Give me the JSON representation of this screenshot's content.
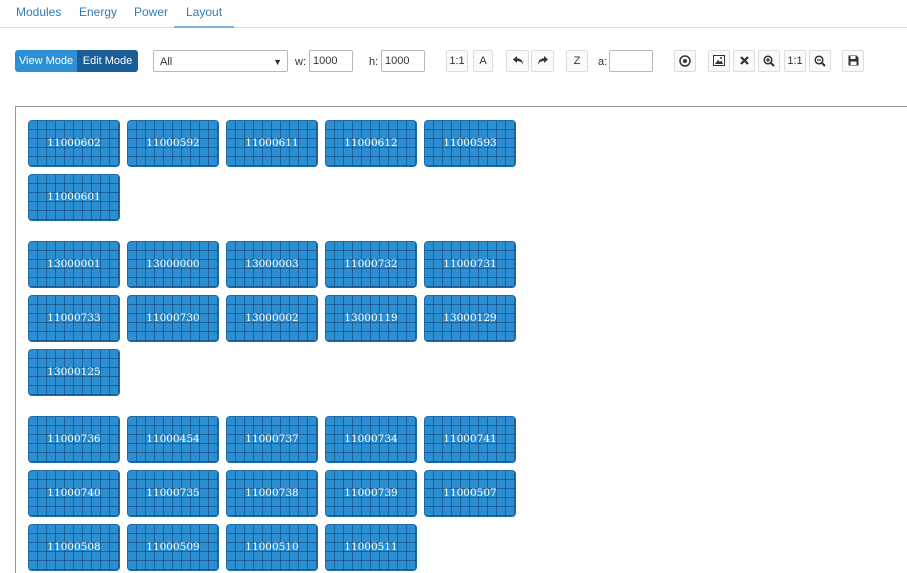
{
  "tabs": [
    {
      "label": "Modules"
    },
    {
      "label": "Energy"
    },
    {
      "label": "Power"
    },
    {
      "label": "Layout",
      "active": true
    }
  ],
  "toolbar": {
    "view_mode": "View Mode",
    "edit_mode": "Edit Mode",
    "filter": {
      "value": "All",
      "options": [
        "All"
      ]
    },
    "width_label": "w:",
    "width_value": "1000",
    "height_label": "h:",
    "height_value": "1000",
    "ratio_label": "1:1",
    "auto_label": "A",
    "undo_icon": "undo-icon",
    "redo_icon": "redo-icon",
    "z_label": "Z",
    "angle_label": "a:",
    "angle_value": "",
    "target_icon": "target-icon",
    "image_icon": "image-icon",
    "clear_icon": "close-icon",
    "zoom_in_icon": "zoom-in-icon",
    "zoom_ratio_label": "1:1",
    "zoom_out_icon": "zoom-out-icon",
    "save_icon": "save-icon"
  },
  "colors": {
    "module_fill": "#2c8fd2",
    "module_grid": "#0f3c6e",
    "view_mode": "#2d8fd4",
    "edit_mode": "#1b5e96",
    "tab_text": "#337ab7"
  },
  "groups": [
    {
      "rows": [
        [
          "11000602",
          "11000592",
          "11000611",
          "11000612",
          "11000593"
        ],
        [
          "11000601"
        ]
      ]
    },
    {
      "rows": [
        [
          "13000001",
          "13000000",
          "13000003",
          "11000732",
          "11000731"
        ],
        [
          "11000733",
          "11000730",
          "13000002",
          "13000119",
          "13000129"
        ],
        [
          "13000125"
        ]
      ]
    },
    {
      "rows": [
        [
          "11000736",
          "11000454",
          "11000737",
          "11000734",
          "11000741"
        ],
        [
          "11000740",
          "11000735",
          "11000738",
          "11000739",
          "11000507"
        ],
        [
          "11000508",
          "11000509",
          "11000510",
          "11000511"
        ]
      ]
    }
  ]
}
